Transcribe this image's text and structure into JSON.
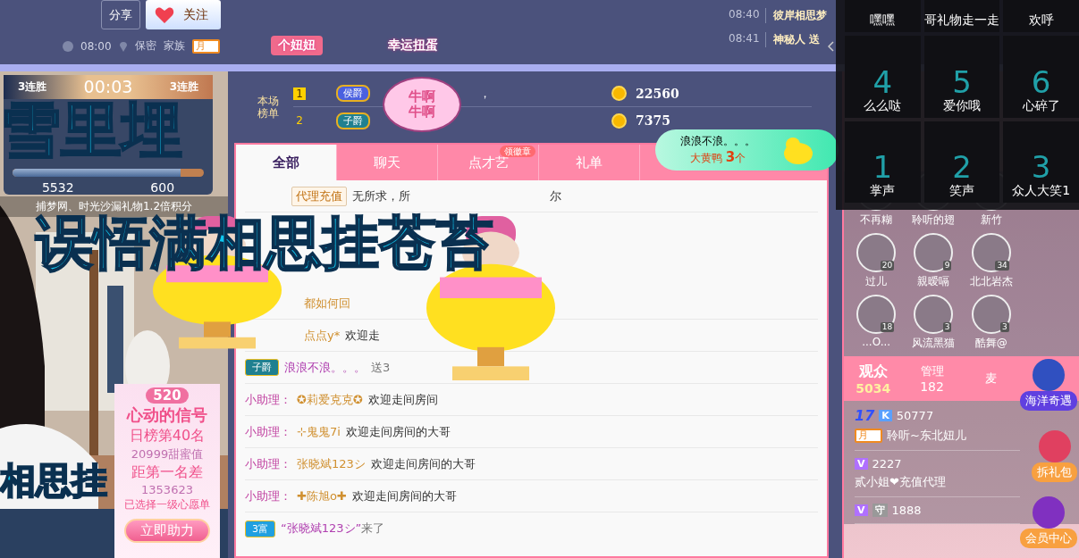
{
  "header": {
    "share": "分享",
    "follow": "关注",
    "time": "08:00",
    "location": "保密",
    "family_label": "家族",
    "family_badge": "月",
    "gift_badges": [
      "个妞妞",
      "幸运扭蛋"
    ],
    "broadcasts": [
      {
        "time": "08:40",
        "text": "彼岸相思梦"
      },
      {
        "time": "08:41",
        "text": "神秘人 送"
      }
    ]
  },
  "pk": {
    "left_streak": "3连胜",
    "timer": "00:03",
    "right_streak": "3连胜",
    "left_score": "5532",
    "right_score": "600",
    "level": 0.88,
    "notice": "捕梦网、时光沙漏礼物1.2倍积分"
  },
  "heart_card": {
    "badge": "520",
    "title": "心动的信号",
    "rank": "日榜第40名",
    "sweet": "20999甜蜜值",
    "gap_label": "距第一名差",
    "gap": "1353623",
    "wish": "已选择一级心愿单",
    "button": "立即助力"
  },
  "rank": {
    "title": "本场榜单",
    "rows": [
      {
        "rank": "1",
        "title": "侯爵",
        "name": "，",
        "score": "22560"
      },
      {
        "rank": "2",
        "title": "子爵",
        "score": "7375"
      }
    ]
  },
  "tabs": [
    {
      "label": "全部",
      "selected": true
    },
    {
      "label": "聊天",
      "selected": false
    },
    {
      "label": "点才艺",
      "selected": false,
      "badge": "领徽章"
    },
    {
      "label": "礼单",
      "selected": false
    }
  ],
  "gift_toast": {
    "sender": "浪浪不浪。。。",
    "gift": "大黄鸭",
    "count": "3",
    "unit": "个"
  },
  "chat": [
    {
      "kind": "tag",
      "tag": "代理充值",
      "text": "无所求，所",
      "tail": "尔"
    },
    {
      "kind": "name",
      "name": "都如何回"
    },
    {
      "kind": "name",
      "name": "点点y*",
      "text": "欢迎走"
    },
    {
      "kind": "gift",
      "title": "子爵",
      "name": "浪浪不浪。。。",
      "text": "送3"
    },
    {
      "kind": "helper",
      "who": "小助理：",
      "name": "✪莉爱克克✪",
      "text": "欢迎走间房间"
    },
    {
      "kind": "helper",
      "who": "小助理：",
      "name": "⊹鬼鬼7i",
      "text": "欢迎走间房间的大哥"
    },
    {
      "kind": "helper",
      "who": "小助理：",
      "name": "张晓斌123シ",
      "text": "欢迎走间房间的大哥"
    },
    {
      "kind": "helper",
      "who": "小助理：",
      "name": "✚陈旭o✚",
      "text": "欢迎走间房间的大哥"
    },
    {
      "kind": "enter",
      "title": "3富",
      "name": "“张晓斌123シ”",
      "text": "来了"
    }
  ],
  "emoji_panel": [
    {
      "label": "嘿嘿"
    },
    {
      "label": "哥礼物走一走"
    },
    {
      "label": "欢呼"
    },
    {
      "number": "4",
      "label": "么么哒"
    },
    {
      "number": "5",
      "label": "爱你哦"
    },
    {
      "number": "6",
      "label": "心碎了"
    },
    {
      "number": "1",
      "label": "掌声"
    },
    {
      "number": "2",
      "label": "笑声"
    },
    {
      "number": "3",
      "label": "众人大笑1"
    }
  ],
  "guards": [
    {
      "name": "不再糊"
    },
    {
      "name": "聆听的翅"
    },
    {
      "name": "新竹"
    },
    {
      "name": "过儿",
      "level": "20"
    },
    {
      "name": "親暧嗝",
      "level": "9"
    },
    {
      "name": "北北岩杰",
      "level": "34"
    },
    {
      "name": "...O...",
      "level": "18"
    },
    {
      "name": "风流黑猫",
      "level": "3"
    },
    {
      "name": "酷舞@",
      "level": "3"
    }
  ],
  "audience_tabs": [
    {
      "label": "观众",
      "count": "5034",
      "selected": true
    },
    {
      "label": "管理",
      "count": "182",
      "selected": false
    },
    {
      "label": "麦",
      "selected": false
    }
  ],
  "viewers": [
    {
      "level": "17",
      "vip": "K",
      "score": "50777",
      "family": "月",
      "name": "聆听~东北妞儿"
    },
    {
      "vip": "V",
      "score": "2227",
      "name": "贰小姐❤充值代理"
    },
    {
      "vip": "V",
      "guard": "守",
      "score": "1888"
    }
  ],
  "side_buttons": [
    "海洋奇遇",
    "拆礼包",
    "会员中心"
  ],
  "danmaku": [
    "雪里埋",
    "误悟满相思挂苍苔",
    "相思挂"
  ],
  "bubble": "牛啊牛啊"
}
